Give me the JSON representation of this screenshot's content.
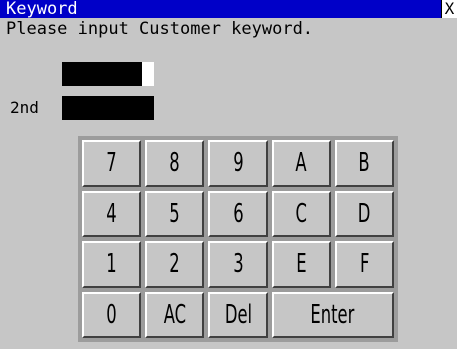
{
  "window": {
    "title": "Keyword",
    "close_label": "X",
    "prompt": "Please input Customer keyword.",
    "second_label": "2nd"
  },
  "keypad": {
    "rows": [
      [
        "7",
        "8",
        "9",
        "A",
        "B"
      ],
      [
        "4",
        "5",
        "6",
        "C",
        "D"
      ],
      [
        "1",
        "2",
        "3",
        "E",
        "F"
      ],
      [
        "0",
        "AC",
        "Del",
        "Enter"
      ]
    ]
  },
  "colors": {
    "titlebar": "#0000c8",
    "background": "#c6c6c6",
    "field": "#000000"
  }
}
